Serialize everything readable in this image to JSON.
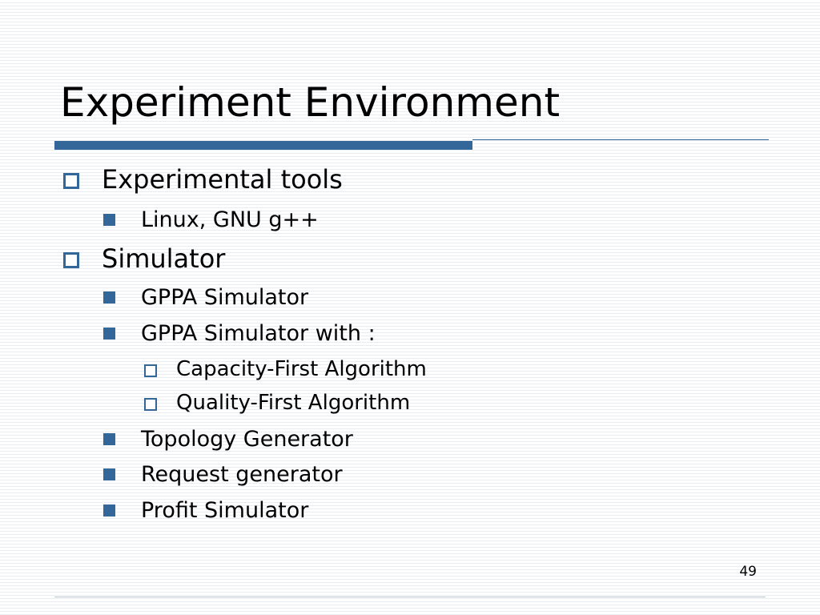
{
  "slide": {
    "title": "Experiment Environment",
    "page_number": "49",
    "accent_color": "#336699",
    "bullets": {
      "experimental_tools": {
        "label": "Experimental tools",
        "sub": [
          "Linux, GNU g++"
        ]
      },
      "simulator": {
        "label": "Simulator",
        "sub": [
          "GPPA Simulator",
          "GPPA Simulator with :",
          "Capacity-First Algorithm",
          "Quality-First Algorithm",
          "Topology Generator",
          "Request generator",
          "Profit Simulator"
        ]
      }
    }
  }
}
